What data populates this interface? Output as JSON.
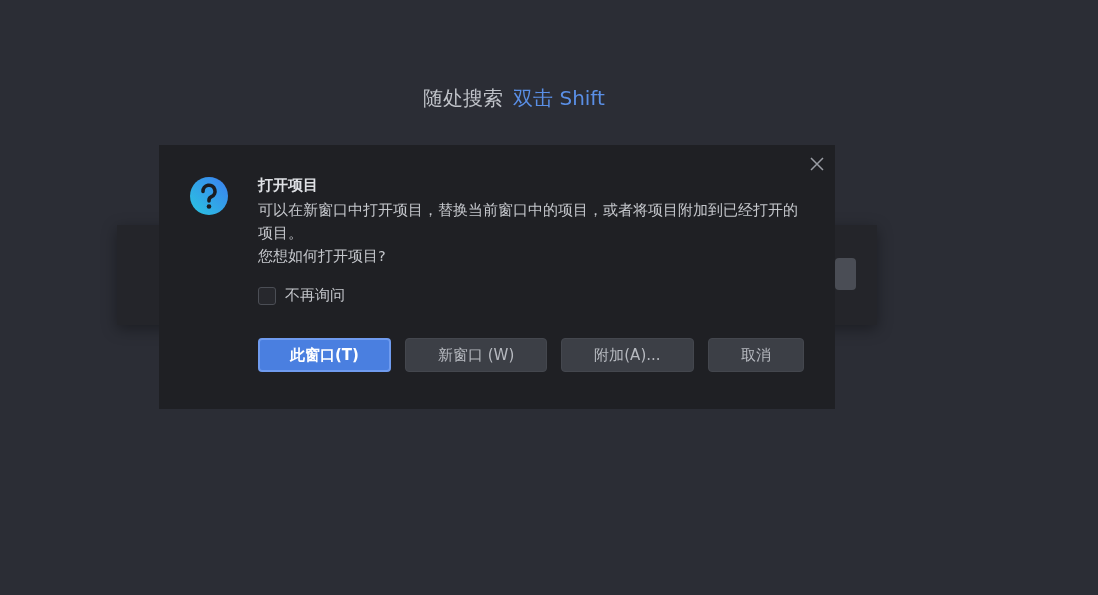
{
  "hints": [
    {
      "label": "随处搜索",
      "shortcut": "双击 Shift"
    }
  ],
  "dialog": {
    "title": "打开项目",
    "message": [
      "可以在新窗口中打开项目，替换当前窗口中的项目，或者将项目附加到已经打开的项目。",
      "您想如何打开项目?"
    ],
    "checkbox": {
      "label": "不再询问",
      "checked": false
    },
    "buttons": [
      {
        "label": "此窗口(T)",
        "selected": true
      },
      {
        "label": "新窗口 (W)",
        "selected": false
      },
      {
        "label": "附加(A)...",
        "selected": false
      },
      {
        "label": "取消",
        "selected": false
      }
    ]
  }
}
